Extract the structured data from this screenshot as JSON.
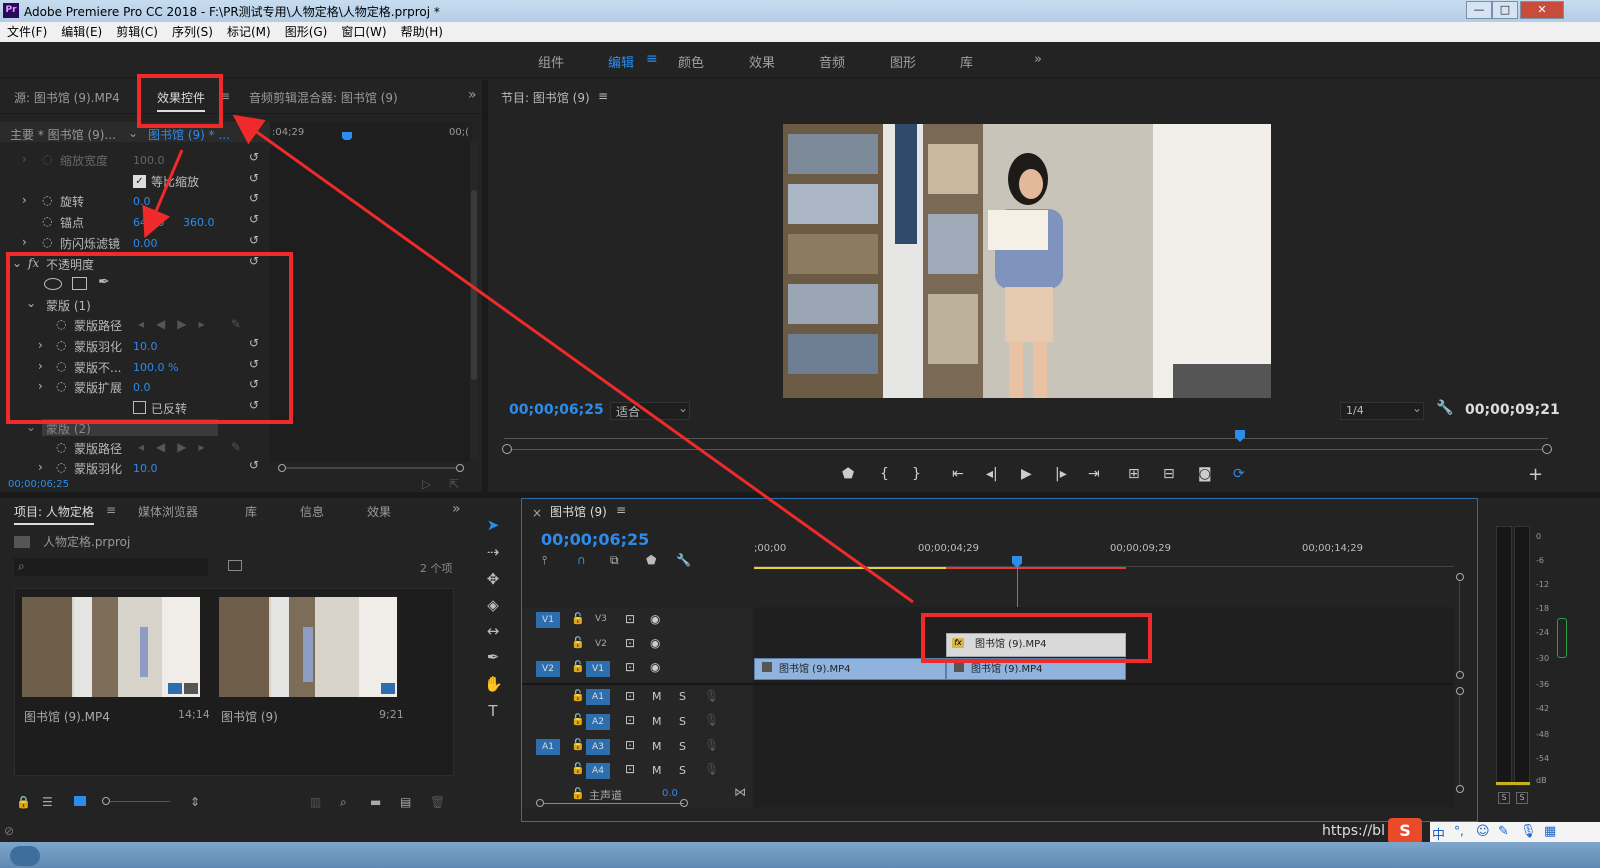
{
  "window": {
    "title": "Adobe Premiere Pro CC 2018 - F:\\PR测试专用\\人物定格\\人物定格.prproj *",
    "logo": "Pr",
    "min": "—",
    "max": "□",
    "close": "✕"
  },
  "menu": [
    "文件(F)",
    "编辑(E)",
    "剪辑(C)",
    "序列(S)",
    "标记(M)",
    "图形(G)",
    "窗口(W)",
    "帮助(H)"
  ],
  "workspaces": {
    "items": [
      "组件",
      "编辑",
      "颜色",
      "效果",
      "音频",
      "图形",
      "库"
    ],
    "active": "编辑",
    "more": "»"
  },
  "effect_panel": {
    "tabs": [
      "源: 图书馆 (9).MP4",
      "效果控件",
      "音频剪辑混合器: 图书馆 (9)"
    ],
    "master": "主要 * 图书馆 (9)...",
    "clip": "图书馆 (9) * ...",
    "time_start": ":04;29",
    "time_end": "00;(",
    "rows": [
      {
        "label": "缩放宽度",
        "value": "100.0"
      },
      {
        "label": "等比缩放",
        "value": ""
      },
      {
        "label": "旋转",
        "value": "0.0"
      },
      {
        "label": "锚点",
        "value": "640.0",
        "value2": "360.0"
      },
      {
        "label": "防闪烁滤镜",
        "value": "0.00"
      },
      {
        "label": "不透明度",
        "value": ""
      },
      {
        "label": "蒙版 (1)",
        "value": ""
      },
      {
        "label": "蒙版路径",
        "value": ""
      },
      {
        "label": "蒙版羽化",
        "value": "10.0"
      },
      {
        "label": "蒙版不...",
        "value": "100.0 %"
      },
      {
        "label": "蒙版扩展",
        "value": "0.0"
      },
      {
        "label": "已反转",
        "value": ""
      },
      {
        "label": "蒙版 (2)",
        "value": ""
      },
      {
        "label": "蒙版路径",
        "value": ""
      },
      {
        "label": "蒙版羽化",
        "value": "10.0"
      }
    ],
    "timecode": "00;00;06;25"
  },
  "program": {
    "title": "节目: 图书馆 (9)",
    "timecode": "00;00;06;25",
    "fit": "适合",
    "resolution": "1/4",
    "duration": "00;00;09;21"
  },
  "project": {
    "tabs": [
      "项目: 人物定格",
      "媒体浏览器",
      "库",
      "信息",
      "效果"
    ],
    "file": "人物定格.prproj",
    "count": "2 个项",
    "items": [
      {
        "name": "图书馆 (9).MP4",
        "duration": "14;14"
      },
      {
        "name": "图书馆 (9)",
        "duration": "9;21"
      }
    ]
  },
  "timeline": {
    "title": "图书馆 (9)",
    "timecode": "00;00;06;25",
    "ruler": [
      ";00;00",
      "00;00;04;29",
      "00;00;09;29",
      "00;00;14;29"
    ],
    "video_tracks": [
      "V3",
      "V2",
      "V1"
    ],
    "audio_tracks": [
      "A1",
      "A2",
      "A3",
      "A4"
    ],
    "source_v": "V1",
    "source_v2": "V2",
    "source_a": "A1",
    "clips": [
      {
        "track": "V2",
        "label": "图书馆 (9).MP4"
      },
      {
        "track": "V1",
        "label": "图书馆 (9).MP4"
      },
      {
        "track": "V1",
        "label": "图书馆 (9).MP4"
      }
    ],
    "master": "主声道",
    "master_value": "0.0",
    "m": "M",
    "s": "S"
  },
  "meter": {
    "ticks": [
      "0",
      "-6",
      "-12",
      "-18",
      "-24",
      "-30",
      "-36",
      "-42",
      "-48",
      "-54",
      "dB"
    ],
    "s": "S"
  },
  "watermark": "https://bl",
  "ime": "中"
}
